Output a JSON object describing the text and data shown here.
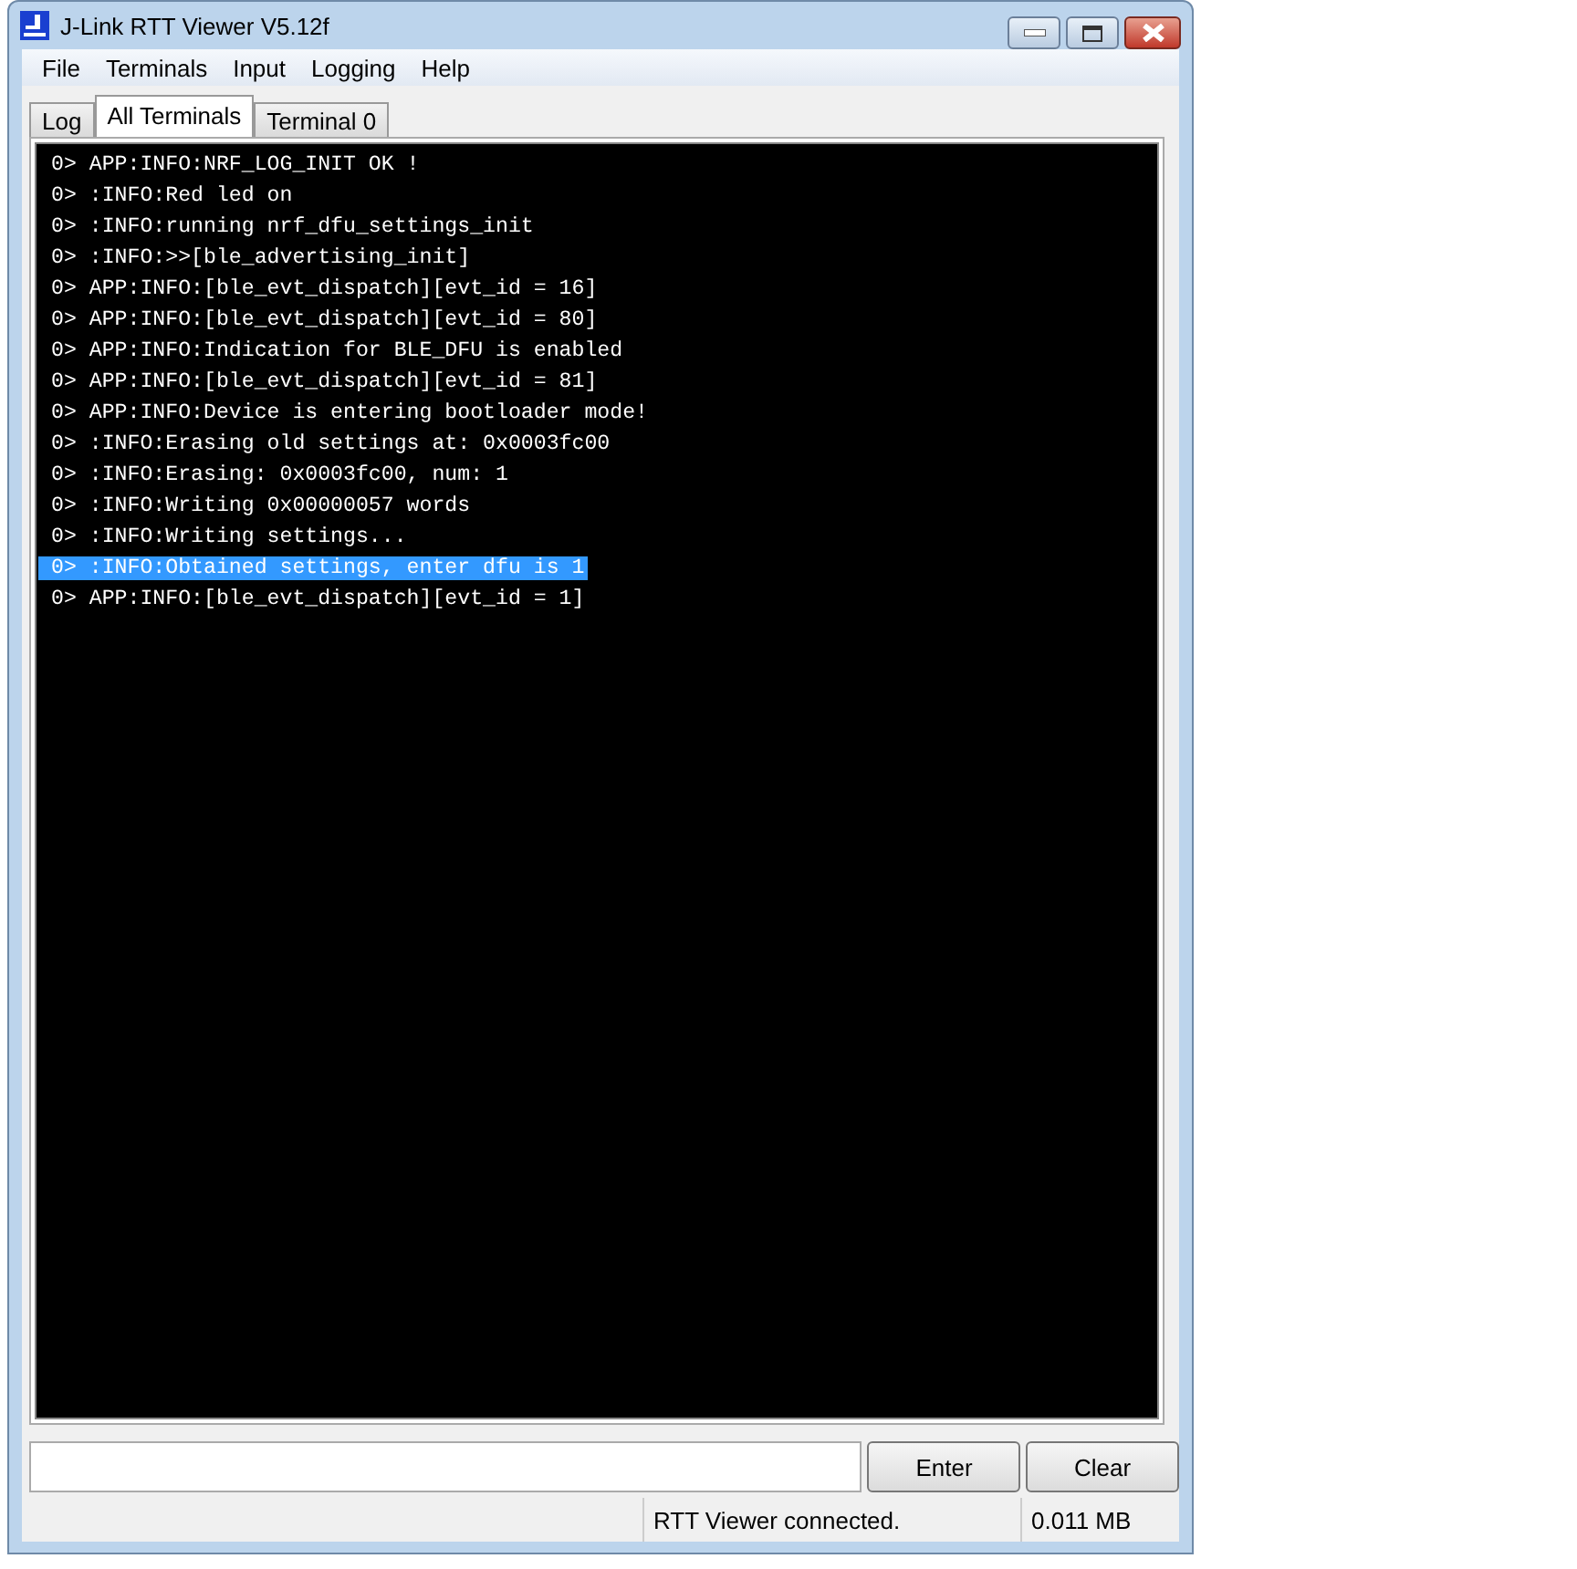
{
  "window": {
    "title": "J-Link RTT Viewer V5.12f"
  },
  "menu": [
    "File",
    "Terminals",
    "Input",
    "Logging",
    "Help"
  ],
  "tabs": [
    {
      "label": "Log",
      "selected": false
    },
    {
      "label": "All Terminals",
      "selected": true
    },
    {
      "label": "Terminal 0",
      "selected": false
    }
  ],
  "terminal_lines": [
    {
      "text": "0> APP:INFO:NRF_LOG_INIT OK !",
      "selected": false
    },
    {
      "text": "0> :INFO:Red led on",
      "selected": false
    },
    {
      "text": "0> :INFO:running nrf_dfu_settings_init",
      "selected": false
    },
    {
      "text": "0> :INFO:>>[ble_advertising_init]",
      "selected": false
    },
    {
      "text": "0> APP:INFO:[ble_evt_dispatch][evt_id = 16]",
      "selected": false
    },
    {
      "text": "0> APP:INFO:[ble_evt_dispatch][evt_id = 80]",
      "selected": false
    },
    {
      "text": "0> APP:INFO:Indication for BLE_DFU is enabled",
      "selected": false
    },
    {
      "text": "0> APP:INFO:[ble_evt_dispatch][evt_id = 81]",
      "selected": false
    },
    {
      "text": "0> APP:INFO:Device is entering bootloader mode!",
      "selected": false
    },
    {
      "text": "0> :INFO:Erasing old settings at: 0x0003fc00",
      "selected": false
    },
    {
      "text": "0> :INFO:Erasing: 0x0003fc00, num: 1",
      "selected": false
    },
    {
      "text": "0> :INFO:Writing 0x00000057 words",
      "selected": false
    },
    {
      "text": "0> :INFO:Writing settings...",
      "selected": false
    },
    {
      "text": "0> :INFO:Obtained settings, enter dfu is 1",
      "selected": true
    },
    {
      "text": "0> APP:INFO:[ble_evt_dispatch][evt_id = 1]",
      "selected": false
    }
  ],
  "buttons": [
    "Enter",
    "Clear"
  ],
  "status_bar": {
    "message": "RTT Viewer connected.",
    "size": "0.011 MB"
  }
}
